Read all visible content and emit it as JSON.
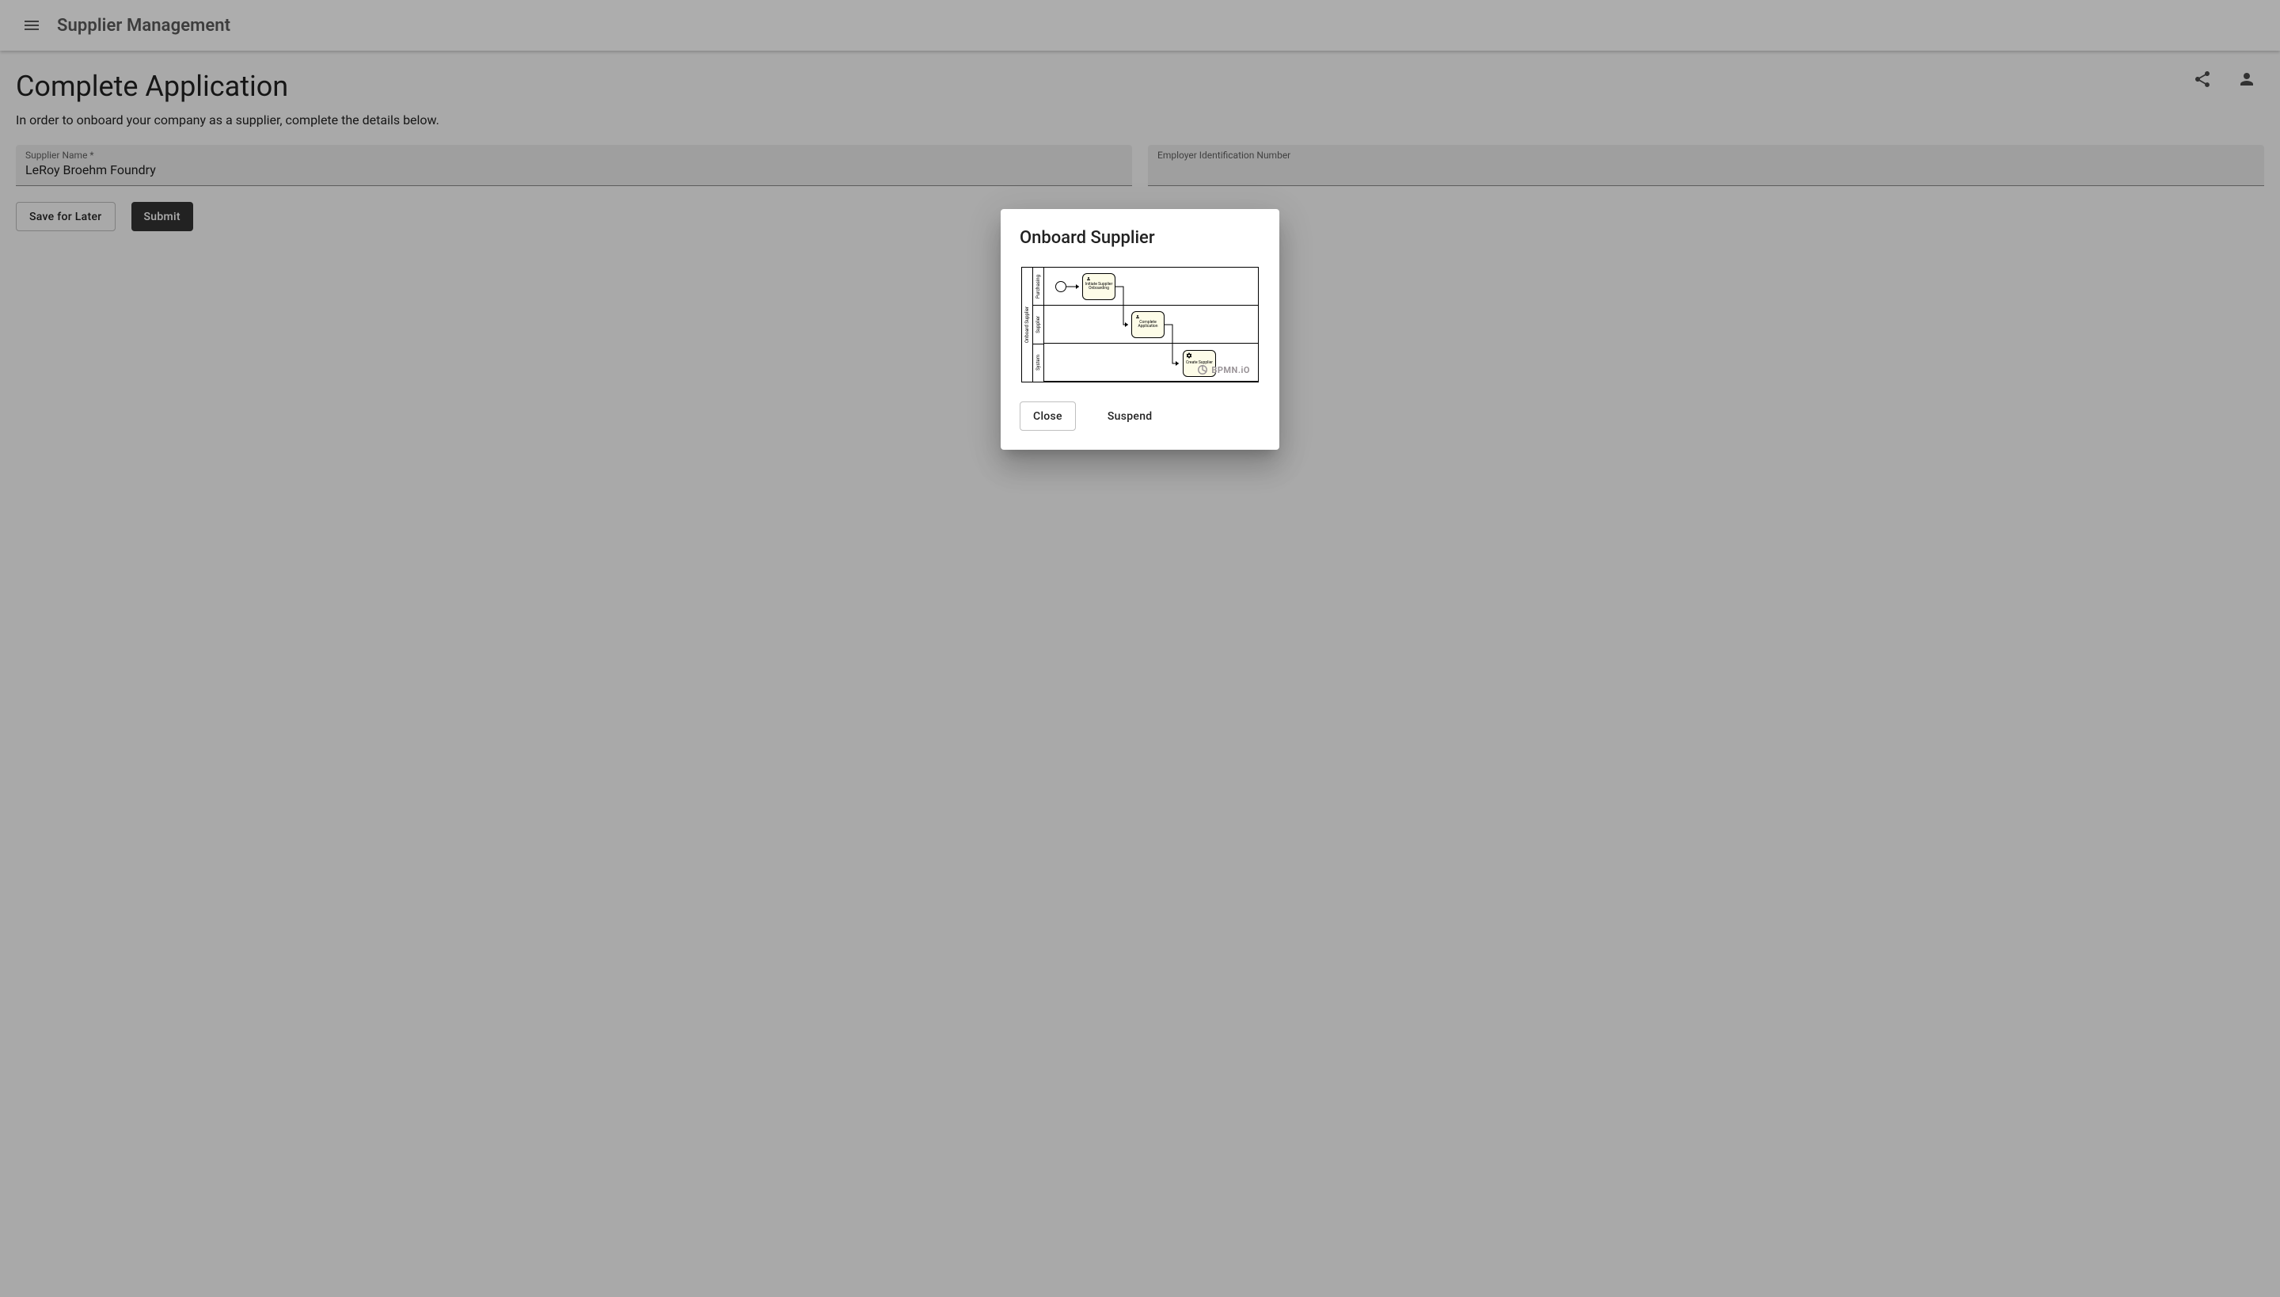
{
  "appbar": {
    "title": "Supplier Management"
  },
  "page": {
    "title": "Complete Application",
    "subtitle": "In order to onboard your company as a supplier, complete the details below.",
    "fields": {
      "supplier_name": {
        "label": "Supplier Name *",
        "value": "LeRoy Broehm Foundry"
      },
      "ein": {
        "label": "Employer Identification Number",
        "value": ""
      }
    },
    "buttons": {
      "save": "Save for Later",
      "submit": "Submit"
    }
  },
  "header_icons": {
    "share": "share-icon",
    "person": "person-icon"
  },
  "dialog": {
    "title": "Onboard Supplier",
    "diagram": {
      "pool_label": "Onboard Supplier",
      "lanes": [
        {
          "label": "Purchasing",
          "task": "Initiate Supplier Onboarding",
          "task_type": "user"
        },
        {
          "label": "Supplier",
          "task": "Complete Application",
          "task_type": "user"
        },
        {
          "label": "System",
          "task": "Create Supplier",
          "task_type": "service"
        }
      ],
      "logo": "BPMN.iO"
    },
    "actions": {
      "close": "Close",
      "suspend": "Suspend"
    }
  },
  "colors": {
    "appbar_bg": "#ffffff",
    "appbar_text": "#5a5a5a",
    "primary_button_bg": "#333333",
    "task_fill": "#fdfce8"
  }
}
